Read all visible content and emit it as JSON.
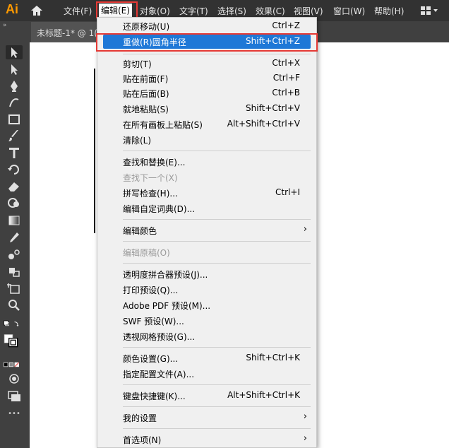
{
  "app": {
    "logo": "Ai"
  },
  "menubar": {
    "items": [
      "文件(F)",
      "编辑(E)",
      "对象(O)",
      "文字(T)",
      "选择(S)",
      "效果(C)",
      "视图(V)",
      "窗口(W)",
      "帮助(H)"
    ]
  },
  "tabbar": {
    "collapse": "»",
    "document_tab": "未标题-1* @ 1("
  },
  "toolbar": {
    "more": "•••"
  },
  "edit_menu": {
    "items": [
      {
        "label": "还原移动(U)",
        "shortcut": "Ctrl+Z"
      },
      {
        "label": "重做(R)圆角半径",
        "shortcut": "Shift+Ctrl+Z"
      },
      {
        "label": "剪切(T)",
        "shortcut": "Ctrl+X"
      },
      {
        "label": "贴在前面(F)",
        "shortcut": "Ctrl+F"
      },
      {
        "label": "贴在后面(B)",
        "shortcut": "Ctrl+B"
      },
      {
        "label": "就地粘贴(S)",
        "shortcut": "Shift+Ctrl+V"
      },
      {
        "label": "在所有画板上粘贴(S)",
        "shortcut": "Alt+Shift+Ctrl+V"
      },
      {
        "label": "清除(L)",
        "shortcut": ""
      },
      {
        "label": "查找和替换(E)...",
        "shortcut": ""
      },
      {
        "label": "查找下一个(X)",
        "shortcut": ""
      },
      {
        "label": "拼写检查(H)...",
        "shortcut": "Ctrl+I"
      },
      {
        "label": "编辑自定词典(D)...",
        "shortcut": ""
      },
      {
        "label": "编辑颜色",
        "shortcut": ""
      },
      {
        "label": "编辑原稿(O)",
        "shortcut": ""
      },
      {
        "label": "透明度拼合器预设(J)...",
        "shortcut": ""
      },
      {
        "label": "打印预设(Q)...",
        "shortcut": ""
      },
      {
        "label": "Adobe PDF 预设(M)...",
        "shortcut": ""
      },
      {
        "label": "SWF 预设(W)...",
        "shortcut": ""
      },
      {
        "label": "透视网格预设(G)...",
        "shortcut": ""
      },
      {
        "label": "颜色设置(G)...",
        "shortcut": "Shift+Ctrl+K"
      },
      {
        "label": "指定配置文件(A)...",
        "shortcut": ""
      },
      {
        "label": "键盘快捷键(K)...",
        "shortcut": "Alt+Shift+Ctrl+K"
      },
      {
        "label": "我的设置",
        "shortcut": ""
      },
      {
        "label": "首选项(N)",
        "shortcut": ""
      }
    ],
    "submenu_arrow": "›"
  },
  "colors": {
    "highlight_border": "#e53935",
    "selection": "#1e78d7"
  }
}
